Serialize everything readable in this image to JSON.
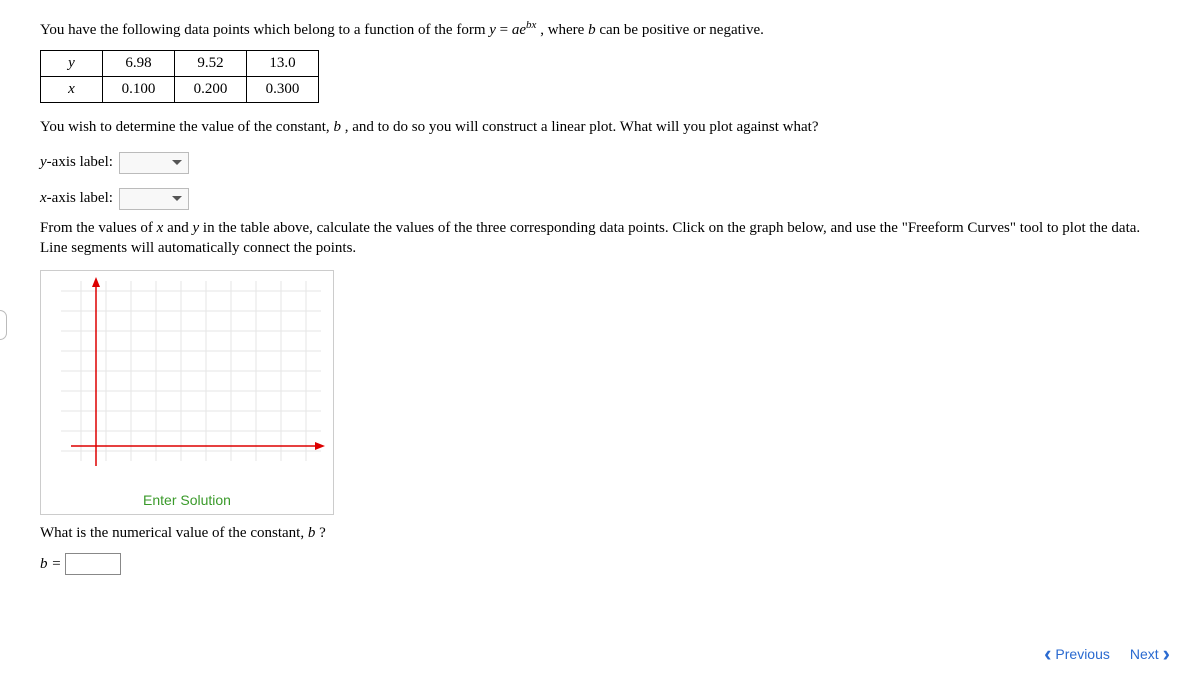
{
  "intro": {
    "p1_a": "You have the following data points which belong to a function of the form ",
    "p1_eq_y": "y",
    "p1_eq_eq": " = ",
    "p1_eq_a": "a",
    "p1_eq_e": "e",
    "p1_eq_bx": "bx",
    "p1_b": ", where ",
    "p1_bvar": "b",
    "p1_c": " can be positive or negative."
  },
  "table": {
    "row_y_label": "y",
    "row_y": [
      "6.98",
      "9.52",
      "13.0"
    ],
    "row_x_label": "x",
    "row_x": [
      "0.100",
      "0.200",
      "0.300"
    ]
  },
  "p2_a": "You wish to determine the value of the constant, ",
  "p2_b": "b",
  "p2_c": ", and to do so you will construct a linear plot. What will you plot against what?",
  "yaxis_label_a": "y",
  "yaxis_label_b": "-axis label:",
  "xaxis_label_a": "x",
  "xaxis_label_b": "-axis label:",
  "p3_a": "From the values of ",
  "p3_x": "x",
  "p3_b": " and ",
  "p3_y": "y",
  "p3_c": " in the table above, calculate the values of the three corresponding data points. Click on the graph below, and use the \"Freeform Curves\" tool to plot the data. Line segments will automatically connect the points.",
  "enter_solution": "Enter Solution",
  "p4_a": "What is the numerical value of the constant, ",
  "p4_b": "b",
  "p4_c": "?",
  "b_equals": "b =",
  "nav": {
    "prev": "Previous",
    "next": "Next"
  }
}
